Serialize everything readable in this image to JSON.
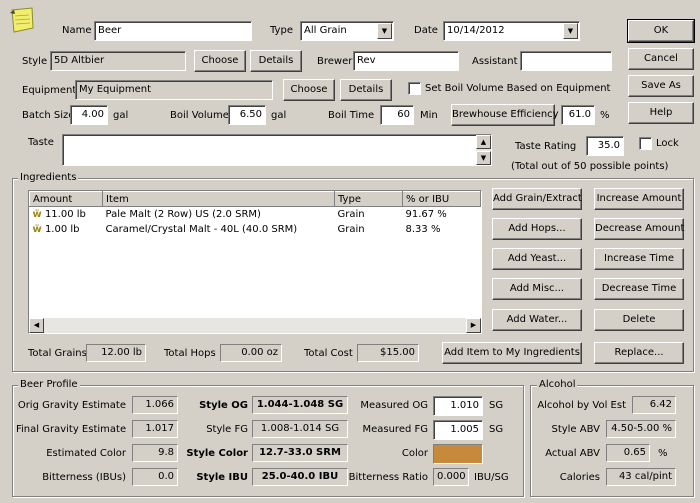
{
  "header": {
    "name_label": "Name",
    "name_value": "Beer",
    "type_label": "Type",
    "type_value": "All Grain",
    "date_label": "Date",
    "date_value": "10/14/2012"
  },
  "style_row": {
    "style_label": "Style",
    "style_value": "5D Altbier",
    "choose_label": "Choose",
    "details_label": "Details",
    "brewer_label": "Brewer",
    "brewer_value": "Rev",
    "assistant_label": "Assistant",
    "assistant_value": ""
  },
  "equipment_row": {
    "equipment_label": "Equipment",
    "equipment_value": "My Equipment",
    "choose_label": "Choose",
    "details_label": "Details",
    "boil_volume_checkbox_label": "Set Boil Volume Based on Equipment"
  },
  "batch_row": {
    "batch_size_label": "Batch Size",
    "batch_size_value": "4.00",
    "batch_unit": "gal",
    "boil_volume_label": "Boil Volume",
    "boil_volume_value": "6.50",
    "boil_volume_unit": "gal",
    "boil_time_label": "Boil Time",
    "boil_time_value": "60",
    "boil_time_unit": "Min",
    "efficiency_button": "Brewhouse Efficiency",
    "efficiency_value": "61.0",
    "efficiency_unit": "%"
  },
  "taste": {
    "taste_label": "Taste",
    "taste_value": "",
    "rating_label": "Taste Rating",
    "rating_value": "35.0",
    "lock_label": "Lock",
    "points_note": "(Total out of 50 possible points)"
  },
  "dialog_buttons": {
    "ok": "OK",
    "cancel": "Cancel",
    "save_as": "Save As",
    "help": "Help"
  },
  "ingredients": {
    "group_title": "Ingredients",
    "columns": [
      "Amount",
      "Item",
      "Type",
      "% or IBU"
    ],
    "rows": [
      {
        "amount": "11.00 lb",
        "item": "Pale Malt (2 Row) US (2.0 SRM)",
        "type": "Grain",
        "pct": "91.67 %"
      },
      {
        "amount": "1.00 lb",
        "item": "Caramel/Crystal Malt - 40L (40.0 SRM)",
        "type": "Grain",
        "pct": "8.33 %"
      }
    ],
    "buttons": {
      "add_grain": "Add Grain/Extract",
      "increase_amount": "Increase Amount",
      "add_hops": "Add Hops...",
      "decrease_amount": "Decrease Amount",
      "add_yeast": "Add Yeast...",
      "increase_time": "Increase Time",
      "add_misc": "Add Misc...",
      "decrease_time": "Decrease Time",
      "add_water": "Add Water...",
      "delete": "Delete",
      "add_to_my": "Add Item to My Ingredients",
      "replace": "Replace..."
    },
    "total_grains_label": "Total Grains",
    "total_grains_value": "12.00 lb",
    "total_hops_label": "Total Hops",
    "total_hops_value": "0.00 oz",
    "total_cost_label": "Total Cost",
    "total_cost_value": "$15.00"
  },
  "beer_profile": {
    "group_title": "Beer Profile",
    "orig_gravity_label": "Orig Gravity Estimate",
    "orig_gravity_value": "1.066",
    "final_gravity_label": "Final Gravity Estimate",
    "final_gravity_value": "1.017",
    "est_color_label": "Estimated Color",
    "est_color_value": "9.8",
    "bitterness_label": "Bitterness (IBUs)",
    "bitterness_value": "0.0",
    "style_og_label": "Style OG",
    "style_og_value": "1.044-1.048 SG",
    "style_fg_label": "Style FG",
    "style_fg_value": "1.008-1.014 SG",
    "style_color_label": "Style Color",
    "style_color_value": "12.7-33.0 SRM",
    "style_ibu_label": "Style IBU",
    "style_ibu_value": "25.0-40.0 IBU",
    "measured_og_label": "Measured OG",
    "measured_og_value": "1.010",
    "measured_og_unit": "SG",
    "measured_fg_label": "Measured FG",
    "measured_fg_value": "1.005",
    "measured_fg_unit": "SG",
    "color_label": "Color",
    "color_swatch": "#c78a3c",
    "bitterness_ratio_label": "Bitterness Ratio",
    "bitterness_ratio_value": "0.000",
    "bitterness_ratio_unit": "IBU/SG"
  },
  "alcohol": {
    "group_title": "Alcohol",
    "abv_est_label": "Alcohol by Vol Est",
    "abv_est_value": "6.42",
    "style_abv_label": "Style ABV",
    "style_abv_value": "4.50-5.00 %",
    "actual_abv_label": "Actual ABV",
    "actual_abv_value": "0.65",
    "actual_abv_unit": "%",
    "calories_label": "Calories",
    "calories_value": "43 cal/pint"
  }
}
